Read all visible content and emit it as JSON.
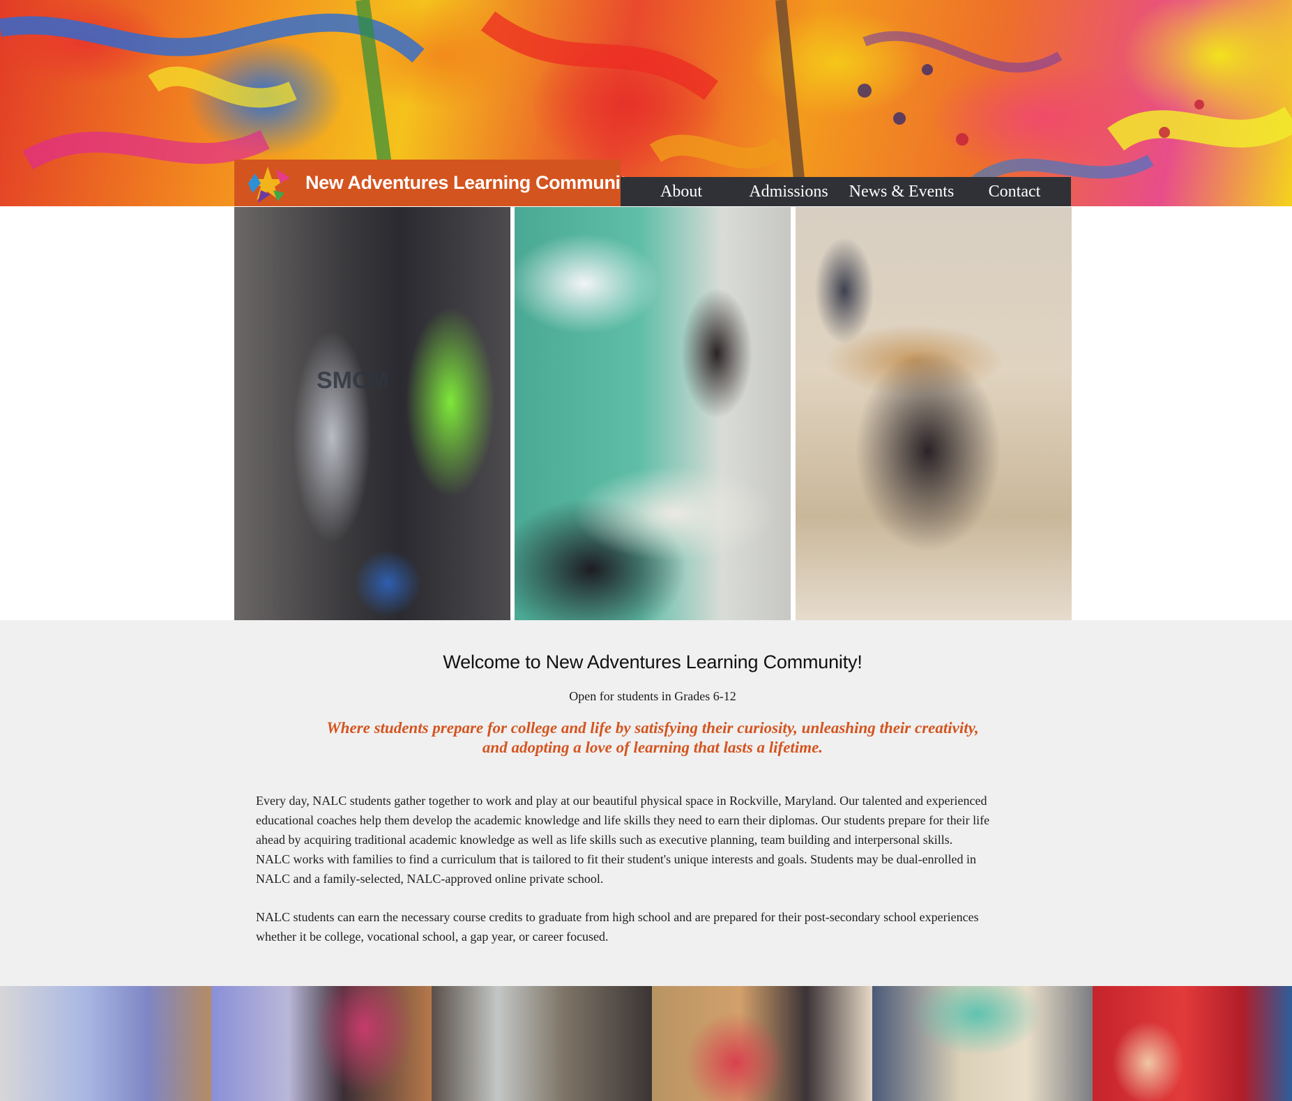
{
  "site": {
    "title": "New Adventures Learning Community",
    "brand_color": "#d4541f",
    "nav_background": "#2f3136",
    "logo_icon": "star-cluster-logo-icon"
  },
  "nav": {
    "items": [
      {
        "label": "About"
      },
      {
        "label": "Admissions"
      },
      {
        "label": "News & Events"
      },
      {
        "label": "Contact"
      }
    ]
  },
  "hero": {
    "photos": [
      {
        "caption_text": "SMCM"
      },
      {
        "caption_text": ""
      },
      {
        "caption_text": ""
      }
    ]
  },
  "welcome": {
    "title": "Welcome to New Adventures Learning Community!",
    "subtitle": "Open for students in Grades 6-12",
    "tagline_line1": "Where students prepare for college and life by satisfying their curiosity, unleashing their creativity,",
    "tagline_line2": "and adopting a love of learning that lasts a  lifetime.",
    "paragraph1_line1": "Every day, NALC students gather together to work and play at our beautiful physical space in Rockville, Maryland. Our talented and experienced",
    "paragraph1_line2": "educational coaches help them develop the academic knowledge and life skills they need to earn their diplomas. Our students prepare for their life",
    "paragraph1_line3": "ahead by acquiring traditional academic knowledge as well as life skills such as executive planning, team building and interpersonal skills.",
    "paragraph1_line4": "NALC works with families to find a curriculum that is tailored to fit their student's unique interests and goals. Students may be dual-enrolled in",
    "paragraph1_line5": "NALC and a family-selected, NALC-approved online private school.",
    "paragraph2_line1": "NALC students can earn the necessary course credits to graduate from high school and are prepared for their post-secondary school experiences",
    "paragraph2_line2": "whether it be college, vocational school, a gap year, or career focused."
  }
}
